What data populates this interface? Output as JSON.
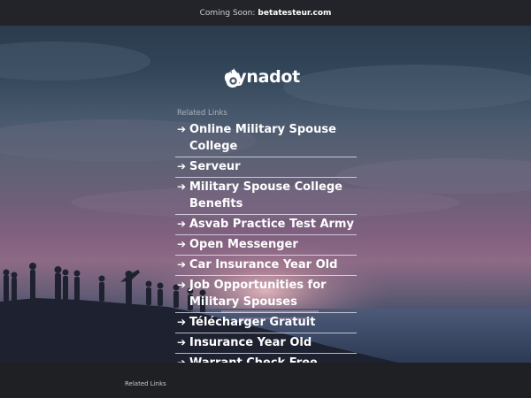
{
  "topbar": {
    "prefix": "Coming Soon:",
    "domain": "betatesteur.com"
  },
  "brand": {
    "name": "dynadot",
    "logo_icon": "flame-icon",
    "logo_color": "#ffffff"
  },
  "related_links": {
    "heading": "Related Links",
    "arrow_glyph": "➔",
    "items": [
      {
        "label": "Online Military Spouse College"
      },
      {
        "label": "Serveur"
      },
      {
        "label": "Military Spouse College Benefits"
      },
      {
        "label": "Asvab Practice Test Army"
      },
      {
        "label": "Open Messenger"
      },
      {
        "label": "Car Insurance Year Old"
      },
      {
        "label": "Job Opportunities for Military Spouses"
      },
      {
        "label": "Télécharger Gratuit"
      },
      {
        "label": "Insurance Year Old"
      },
      {
        "label": "Warrant Check Free"
      }
    ]
  },
  "footer": {
    "related_links_label": "Related Links"
  },
  "colors": {
    "topbar_bg": "#232429",
    "footer_bg": "#1f2024",
    "link_text": "#ffffff",
    "heading_text": "#aab1bd"
  }
}
